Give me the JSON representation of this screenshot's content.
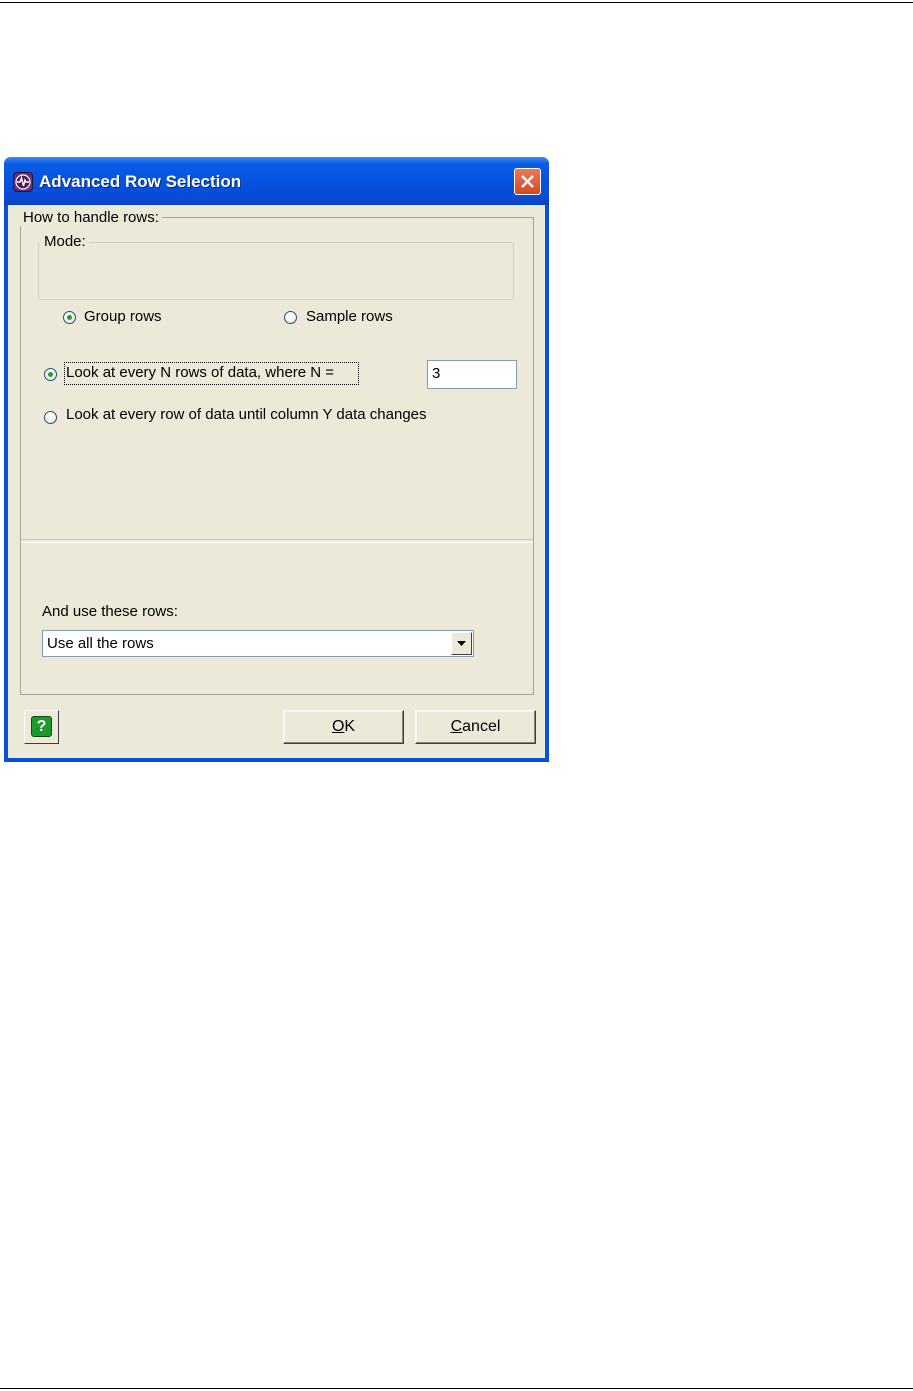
{
  "window": {
    "title": "Advanced Row Selection"
  },
  "rows_group": {
    "legend": "How to handle rows:"
  },
  "mode_group": {
    "legend": "Mode:",
    "options": [
      {
        "label": "Group rows",
        "selected": true
      },
      {
        "label": "Sample rows",
        "selected": false
      }
    ]
  },
  "handling": {
    "option_n_rows": {
      "label": "Look at every N rows of data, where N =",
      "selected": true
    },
    "n_value": "3",
    "option_until_change": {
      "label": "Look at every row of data until column Y data changes",
      "selected": false
    }
  },
  "use_rows": {
    "label": "And use these rows:",
    "selected_value": "Use all the rows"
  },
  "buttons": {
    "help_glyph": "?",
    "ok_accel": "O",
    "ok_rest": "K",
    "cancel_accel": "C",
    "cancel_rest": "ancel"
  },
  "colors": {
    "titlebar": "#0551e0",
    "dialog_face": "#ece9d8",
    "close_button": "#d24a25",
    "radio_dot": "#21a121",
    "help_button": "#1e9a2a"
  },
  "icons": {
    "app": "waveform-icon",
    "close": "close-icon",
    "dropdown": "chevron-down-icon",
    "help": "help-icon"
  }
}
